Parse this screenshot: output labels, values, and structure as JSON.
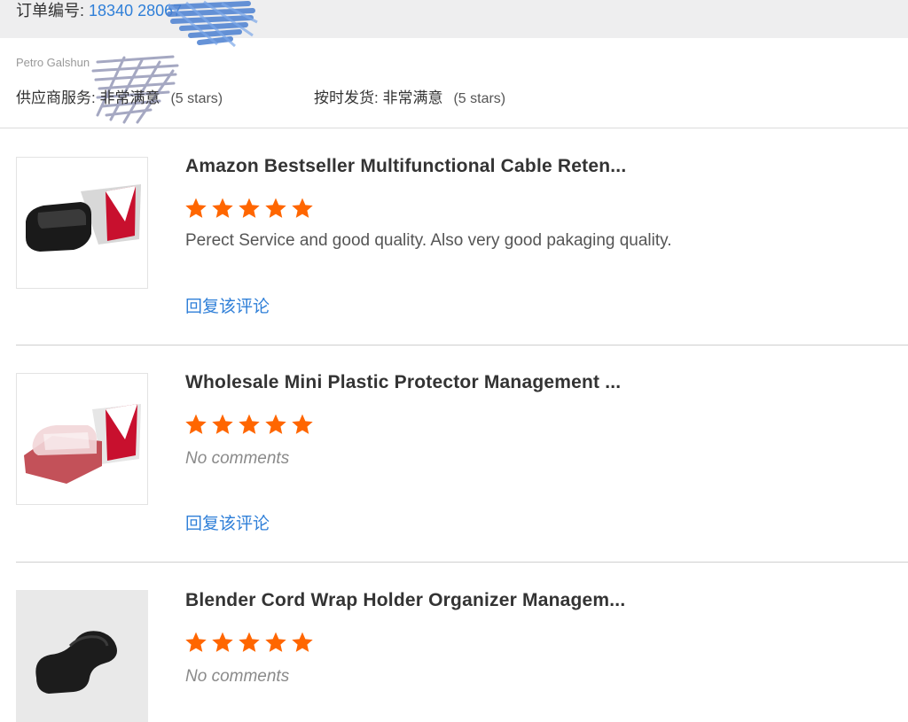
{
  "order": {
    "label": "订单编号:",
    "number": "18340 28067"
  },
  "buyer_name": "Petro Galshun",
  "ratings": {
    "service": {
      "label": "供应商服务: 非常满意",
      "stars": "(5 stars)"
    },
    "shipping": {
      "label": "按时发货: 非常满意",
      "stars": "(5 stars)"
    }
  },
  "reviews": [
    {
      "title": "Amazon Bestseller Multifunctional Cable Reten...",
      "rating": 5,
      "comment": "Perect Service and good quality.  Also very good pakaging quality.",
      "reply_label": "回复该评论"
    },
    {
      "title": "Wholesale Mini Plastic Protector Management ...",
      "rating": 5,
      "comment": "No comments",
      "reply_label": "回复该评论"
    },
    {
      "title": "Blender Cord Wrap Holder Organizer Managem...",
      "rating": 5,
      "comment": "No comments"
    }
  ],
  "colors": {
    "star": "#ff6600",
    "link": "#2f7fd8"
  }
}
